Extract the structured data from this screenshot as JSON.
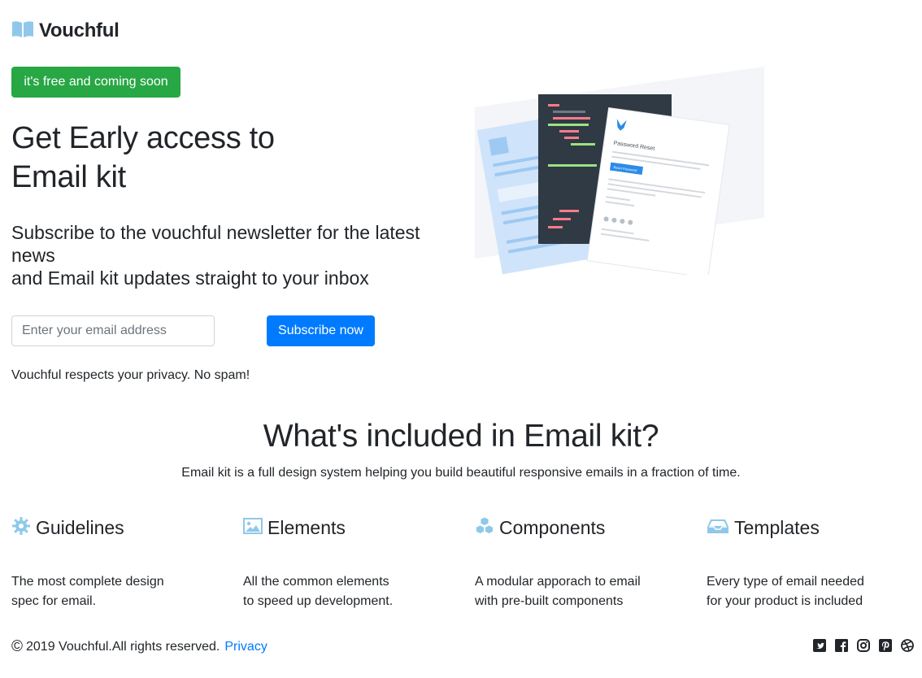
{
  "brand": {
    "name": "Vouchful",
    "accent": "#28a745",
    "primary": "#007bff",
    "icon": "book-icon"
  },
  "badge": {
    "label": "it's free and coming soon"
  },
  "hero": {
    "title_line1": "Get Early access to",
    "title_line2": "Email kit",
    "subtitle_line1": "Subscribe to the vouchful newsletter for the latest",
    "subtitle_line2": "news",
    "subtitle_line3": "and Email kit updates straight to your inbox"
  },
  "form": {
    "email_placeholder": "Enter your email address",
    "email_value": "",
    "submit_label": "Subscribe now",
    "privacy_note": "Vouchful respects your privacy. No spam!"
  },
  "illustration": {
    "card_title": "Password Reset",
    "card_button": "Reset Password"
  },
  "included": {
    "title": "What's included in Email kit?",
    "description": "Email kit is a full design system helping you build beautiful responsive emails in a fraction of time.",
    "features": [
      {
        "icon": "gear-icon",
        "title": "Guidelines",
        "desc_line1": "The most complete design",
        "desc_line2": "spec for email."
      },
      {
        "icon": "image-icon",
        "title": "Elements",
        "desc_line1": "All the common elements",
        "desc_line2": "to speed up development."
      },
      {
        "icon": "cubes-icon",
        "title": "Components",
        "desc_line1": "A modular apporach to email",
        "desc_line2": "with pre-built components"
      },
      {
        "icon": "inbox-icon",
        "title": "Templates",
        "desc_line1": "Every type of email needed",
        "desc_line2": "for your product is included"
      }
    ]
  },
  "footer": {
    "copyright_symbol": "©",
    "copyright": "2019 Vouchful.All rights reserved.",
    "privacy_link": "Privacy",
    "social_icons": [
      "twitter-icon",
      "facebook-icon",
      "instagram-icon",
      "pinterest-icon",
      "dribbble-icon"
    ]
  }
}
